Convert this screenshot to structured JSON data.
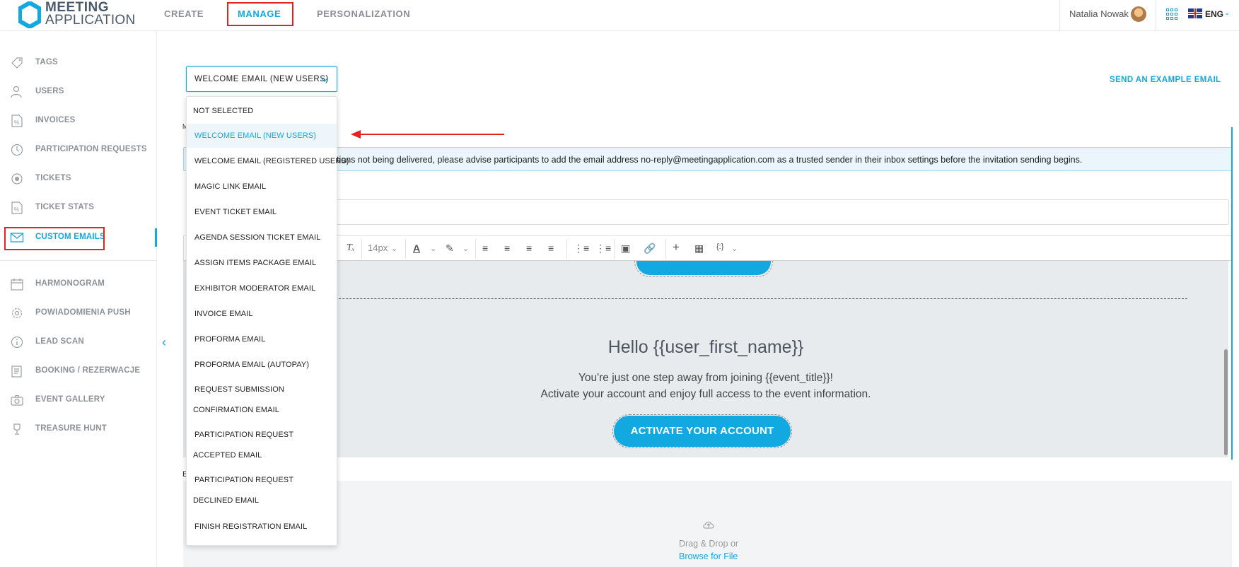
{
  "header": {
    "logo_line1": "MEETING",
    "logo_line2": "APPLICATION",
    "nav": [
      {
        "label": "CREATE"
      },
      {
        "label": "MANAGE"
      },
      {
        "label": "PERSONALIZATION"
      }
    ],
    "user_name": "Natalia Nowak",
    "language": "ENG"
  },
  "sidebar": {
    "items": [
      {
        "label": "TAGS",
        "icon": "tag-icon"
      },
      {
        "label": "USERS",
        "icon": "users-icon"
      },
      {
        "label": "INVOICES",
        "icon": "invoice-icon"
      },
      {
        "label": "PARTICIPATION REQUESTS",
        "icon": "clock-icon"
      },
      {
        "label": "TICKETS",
        "icon": "ticket-icon"
      },
      {
        "label": "TICKET STATS",
        "icon": "ticket-stats-icon"
      },
      {
        "label": "CUSTOM EMAILS",
        "icon": "envelope-icon"
      },
      {
        "label": "HARMONOGRAM",
        "icon": "calendar-icon"
      },
      {
        "label": "POWIADOMIENIA PUSH",
        "icon": "gear-icon"
      },
      {
        "label": "LEAD SCAN",
        "icon": "info-icon"
      },
      {
        "label": "BOOKING / REZERWACJE",
        "icon": "booking-icon"
      },
      {
        "label": "EVENT GALLERY",
        "icon": "camera-icon"
      },
      {
        "label": "TREASURE HUNT",
        "icon": "trophy-icon"
      }
    ]
  },
  "email_select": {
    "value": "WELCOME EMAIL (NEW USERS)",
    "options": [
      "NOT SELECTED",
      "WELCOME EMAIL (NEW USERS)",
      "WELCOME EMAIL (REGISTERED USERS)",
      "MAGIC LINK EMAIL",
      "EVENT TICKET EMAIL",
      "AGENDA SESSION TICKET EMAIL",
      "ASSIGN ITEMS PACKAGE EMAIL",
      "EXHIBITOR MODERATOR EMAIL",
      "INVOICE EMAIL",
      "PROFORMA EMAIL",
      "PROFORMA EMAIL (AUTOPAY)",
      "REQUEST SUBMISSION CONFIRMATION EMAIL",
      "PARTICIPATION REQUEST ACCEPTED EMAIL",
      "PARTICIPATION REQUEST DECLINED EMAIL",
      "FINISH REGISTRATION EMAIL"
    ]
  },
  "send_example": "SEND AN EXAMPLE EMAIL",
  "m_label": "M",
  "notice": "tions not being delivered, please advise participants to add the email address no-reply@meetingapplication.com as a trusted sender in their inbox settings before the invitation sending begins.",
  "toolbar": {
    "font_size": "14px"
  },
  "editor": {
    "hello": "Hello {{user_first_name}}",
    "line1": "You're just one step away from joining {{event_title}}!",
    "line2": "Activate your account and enjoy full access to the event information.",
    "button": "ACTIVATE YOUR ACCOUNT"
  },
  "b_label": "E",
  "dropzone": {
    "text": "Drag & Drop or",
    "link": "Browse for File"
  },
  "colors": {
    "accent": "#12a8e0",
    "highlight": "#e3231f"
  }
}
